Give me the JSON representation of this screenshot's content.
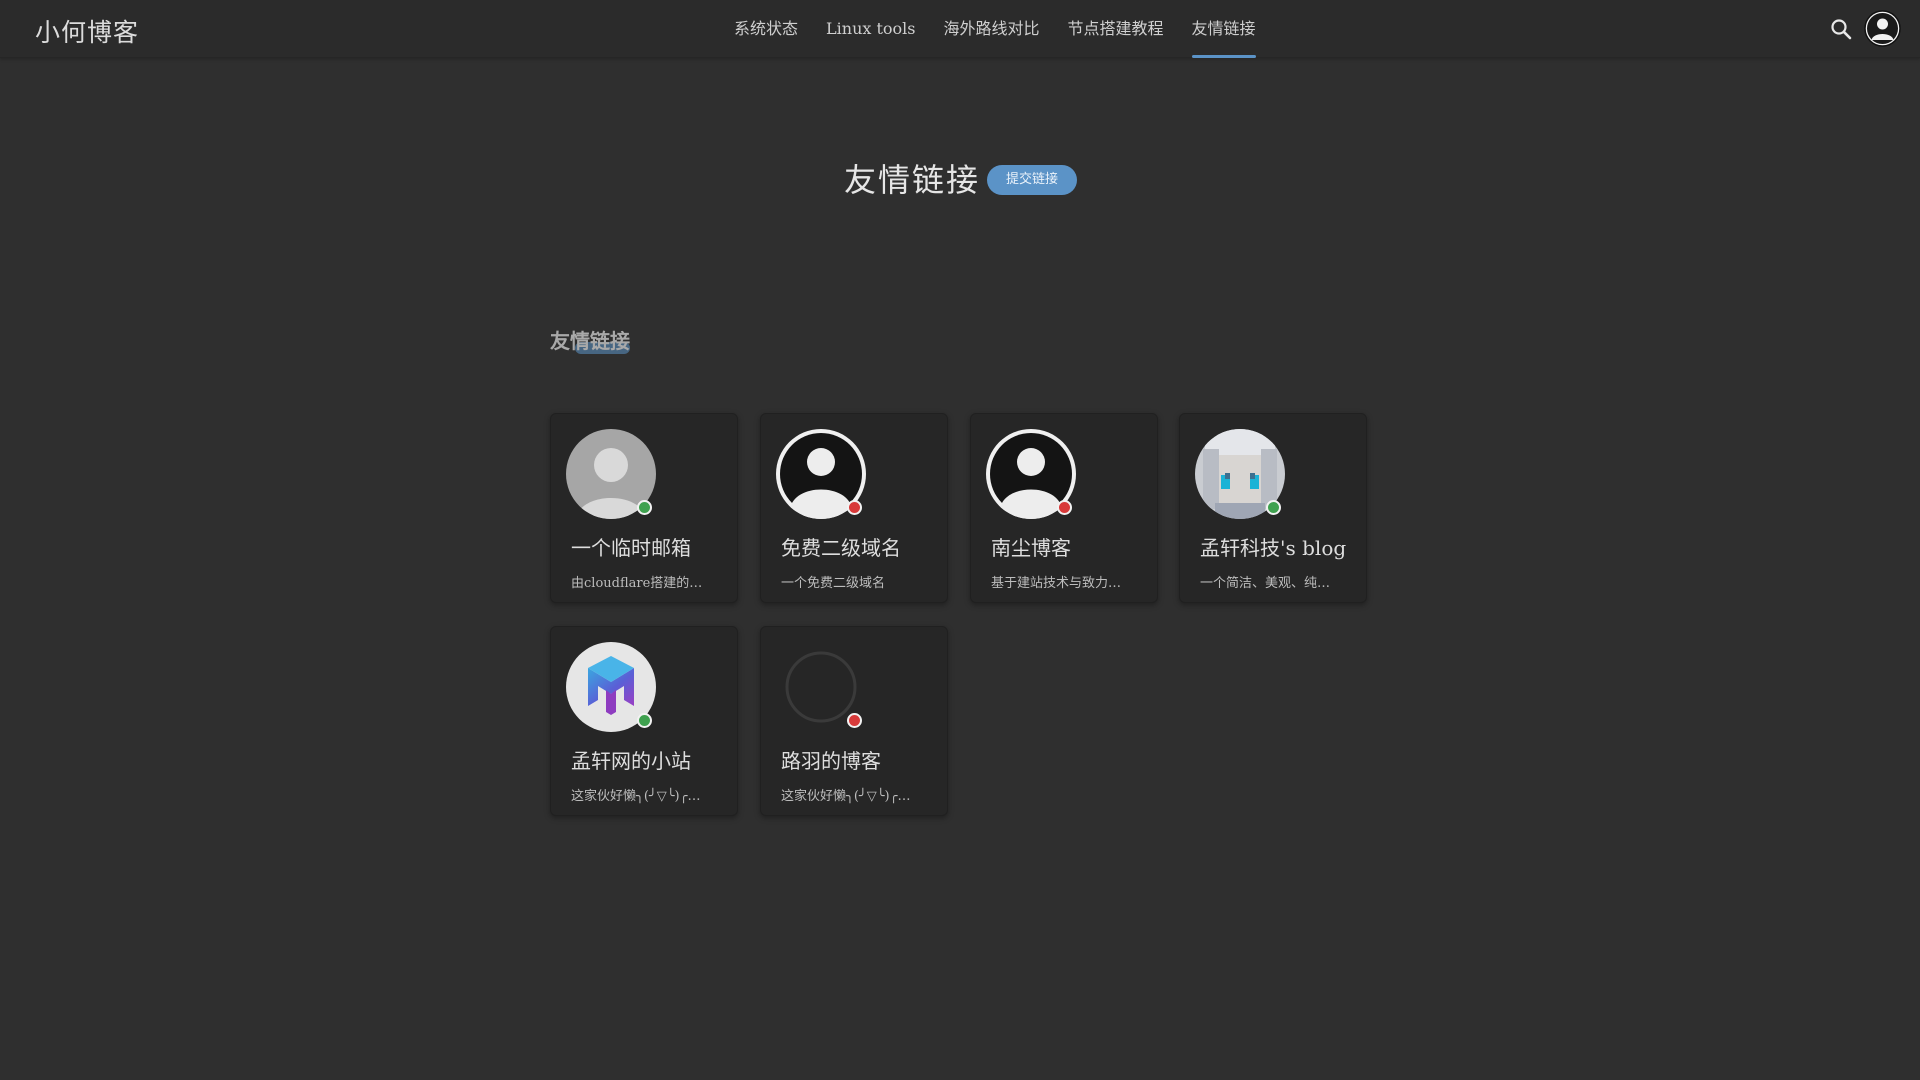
{
  "header": {
    "brand": "小何博客",
    "nav": [
      {
        "label": "系统状态",
        "active": false
      },
      {
        "label": "Linux tools",
        "active": false
      },
      {
        "label": "海外路线对比",
        "active": false
      },
      {
        "label": "节点搭建教程",
        "active": false
      },
      {
        "label": "友情链接",
        "active": true
      }
    ],
    "icons": {
      "search": "search-icon",
      "user": "user-avatar-icon"
    }
  },
  "page": {
    "title": "友情链接",
    "submit_button": "提交链接"
  },
  "section": {
    "title": "友情链接"
  },
  "colors": {
    "accent": "#5b93c7",
    "online": "#3fa14f",
    "offline": "#d83a3a",
    "background": "#2f2f2f",
    "card": "#262626"
  },
  "friends": [
    {
      "name": "一个临时邮箱",
      "desc": "由cloudflare搭建的…",
      "status": "online",
      "avatar": "default-gray-avatar"
    },
    {
      "name": "免费二级域名",
      "desc": "一个免费二级域名",
      "status": "offline",
      "avatar": "default-dark-avatar"
    },
    {
      "name": "南尘博客",
      "desc": "基于建站技术与致力…",
      "status": "offline",
      "avatar": "default-dark-avatar"
    },
    {
      "name": "孟轩科技's blog",
      "desc": "一个简洁、美观、纯…",
      "status": "online",
      "avatar": "pixel-anime-avatar"
    },
    {
      "name": "孟轩网的小站",
      "desc": "这家伙好懒╮(╯▽╰)╭…",
      "status": "online",
      "avatar": "m-logo-avatar"
    },
    {
      "name": "路羽的博客",
      "desc": "这家伙好懒╮(╯▽╰)╭…",
      "status": "offline",
      "avatar": "loading-ring-avatar"
    }
  ]
}
